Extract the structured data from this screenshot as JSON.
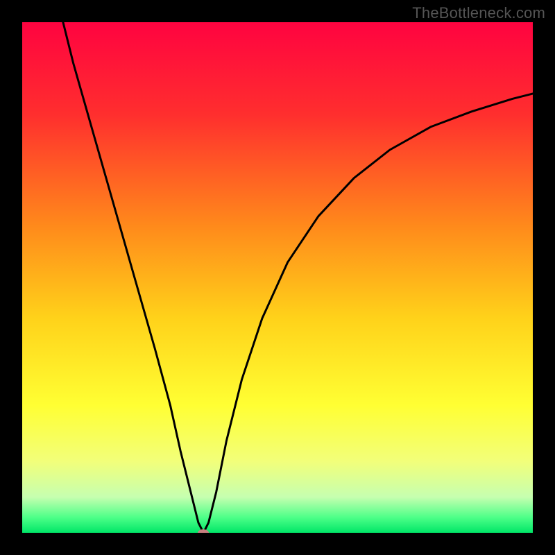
{
  "watermark": "TheBottleneck.com",
  "chart_data": {
    "type": "line",
    "title": "",
    "xlabel": "",
    "ylabel": "",
    "xlim": [
      0,
      100
    ],
    "ylim": [
      0,
      100
    ],
    "gradient_stops": [
      {
        "offset": 0,
        "color": "#ff0340"
      },
      {
        "offset": 18,
        "color": "#ff2e2e"
      },
      {
        "offset": 40,
        "color": "#ff8a1b"
      },
      {
        "offset": 58,
        "color": "#ffd21a"
      },
      {
        "offset": 75,
        "color": "#ffff33"
      },
      {
        "offset": 86,
        "color": "#f2ff7a"
      },
      {
        "offset": 93,
        "color": "#c6ffb0"
      },
      {
        "offset": 97,
        "color": "#4dff88"
      },
      {
        "offset": 100,
        "color": "#00e667"
      }
    ],
    "series": [
      {
        "name": "curve",
        "color": "#000000",
        "points": [
          {
            "x": 8.0,
            "y": 100.0
          },
          {
            "x": 10.0,
            "y": 92.0
          },
          {
            "x": 14.0,
            "y": 78.0
          },
          {
            "x": 18.0,
            "y": 64.0
          },
          {
            "x": 22.0,
            "y": 50.0
          },
          {
            "x": 26.0,
            "y": 36.0
          },
          {
            "x": 29.0,
            "y": 25.0
          },
          {
            "x": 31.0,
            "y": 16.0
          },
          {
            "x": 33.0,
            "y": 8.0
          },
          {
            "x": 34.5,
            "y": 2.0
          },
          {
            "x": 35.5,
            "y": 0.0
          },
          {
            "x": 36.5,
            "y": 2.0
          },
          {
            "x": 38.0,
            "y": 8.0
          },
          {
            "x": 40.0,
            "y": 18.0
          },
          {
            "x": 43.0,
            "y": 30.0
          },
          {
            "x": 47.0,
            "y": 42.0
          },
          {
            "x": 52.0,
            "y": 53.0
          },
          {
            "x": 58.0,
            "y": 62.0
          },
          {
            "x": 65.0,
            "y": 69.5
          },
          {
            "x": 72.0,
            "y": 75.0
          },
          {
            "x": 80.0,
            "y": 79.5
          },
          {
            "x": 88.0,
            "y": 82.5
          },
          {
            "x": 96.0,
            "y": 85.0
          },
          {
            "x": 100.0,
            "y": 86.0
          }
        ]
      }
    ],
    "marker": {
      "x": 35.5,
      "y": 0.0,
      "color": "#c98080"
    }
  }
}
